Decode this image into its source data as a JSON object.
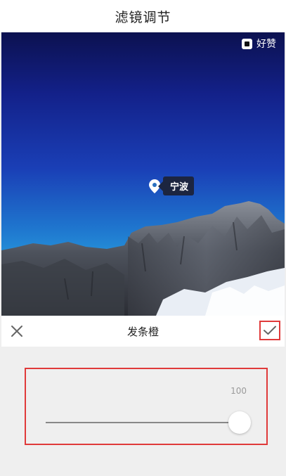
{
  "header": {
    "title": "滤镜调节"
  },
  "photo": {
    "watermark": "好赞",
    "location": "宁波"
  },
  "filter_bar": {
    "name": "发条橙",
    "close_icon": "close-icon",
    "confirm_icon": "check-icon"
  },
  "slider": {
    "value_label": "100",
    "value": 100,
    "min": 0,
    "max": 100
  },
  "colors": {
    "highlight": "#e03a3a",
    "background": "#efefef",
    "bar": "#ffffff",
    "location_tag": "#1c2540"
  }
}
